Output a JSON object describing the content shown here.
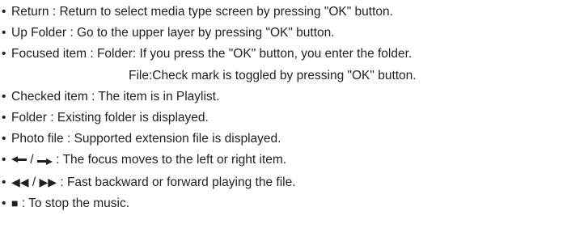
{
  "items": [
    {
      "term": "Return",
      "desc": "Return to select media type screen by pressing \"OK\" button."
    },
    {
      "term": "Up Folder",
      "desc": "Go to the upper layer by pressing \"OK\" button."
    },
    {
      "term": "Focused item",
      "desc": "Folder: If you press the \"OK\" button, you enter the folder.",
      "continuation": "File:Check mark is toggled by pressing \"OK\" button."
    },
    {
      "term": "Checked item",
      "desc": "The item is in Playlist."
    },
    {
      "term": "Folder",
      "desc": "Existing folder is displayed."
    },
    {
      "term": "Photo file",
      "desc": "Supported extension file is displayed."
    }
  ],
  "symbol_items": [
    {
      "symbol": "left-right-arrow-keys",
      "separator": " / ",
      "desc": "The focus moves to the left or right item."
    },
    {
      "symbol": "rewind-fastforward-keys",
      "rewind": "◀◀",
      "forward": "▶▶",
      "separator": " / ",
      "desc": "Fast backward or forward playing the file."
    },
    {
      "symbol": "stop-key",
      "stop": "■",
      "desc": "To stop the music."
    }
  ],
  "bullet": "•",
  "colon": " : "
}
